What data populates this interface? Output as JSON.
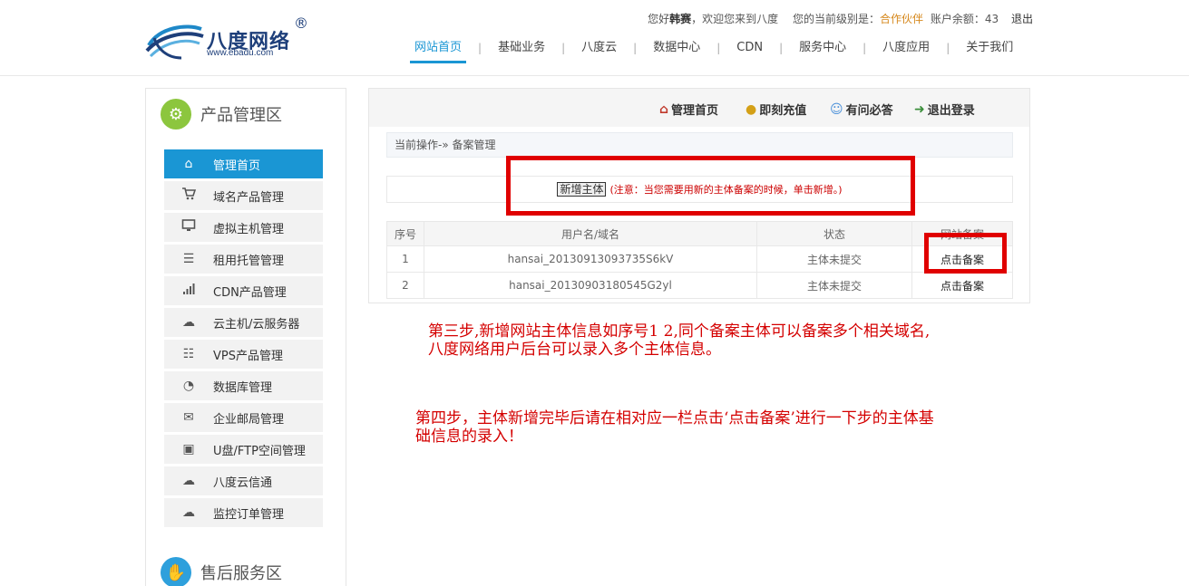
{
  "header": {
    "logo_text": "八度网络",
    "logo_url": "www.ebadu.com",
    "logo_reg": "®",
    "greeting": "您好",
    "username": "韩赛",
    "welcome": "，欢迎您来到八度",
    "level_label": "您的当前级别是：",
    "level_value": "合作伙伴",
    "balance_label": "账户余额：",
    "balance_value": "43",
    "logout": "退出"
  },
  "nav": [
    {
      "label": "网站首页"
    },
    {
      "label": "基础业务"
    },
    {
      "label": "八度云"
    },
    {
      "label": "数据中心"
    },
    {
      "label": "CDN"
    },
    {
      "label": "服务中心"
    },
    {
      "label": "八度应用"
    },
    {
      "label": "关于我们"
    }
  ],
  "nav_separator": "|",
  "sidebar": {
    "section1_title": "产品管理区",
    "section2_title": "售后服务区",
    "items": [
      {
        "label": "管理首页",
        "icon": "home-icon",
        "glyph": "⌂"
      },
      {
        "label": "域名产品管理",
        "icon": "cart-icon",
        "glyph": "🛒"
      },
      {
        "label": "虚拟主机管理",
        "icon": "monitor-icon",
        "glyph": "▭"
      },
      {
        "label": "租用托管管理",
        "icon": "list-icon",
        "glyph": "☰"
      },
      {
        "label": "CDN产品管理",
        "icon": "signal-icon",
        "glyph": "▮"
      },
      {
        "label": "云主机/云服务器",
        "icon": "cloud-icon",
        "glyph": "☁"
      },
      {
        "label": "VPS产品管理",
        "icon": "grid-list-icon",
        "glyph": "☷"
      },
      {
        "label": "数据库管理",
        "icon": "pie-icon",
        "glyph": "◔"
      },
      {
        "label": "企业邮局管理",
        "icon": "mail-icon",
        "glyph": "✉"
      },
      {
        "label": "U盘/FTP空间管理",
        "icon": "usb-icon",
        "glyph": "▣"
      },
      {
        "label": "八度云信通",
        "icon": "cloud-icon",
        "glyph": "☁"
      },
      {
        "label": "监控订单管理",
        "icon": "cloud-icon",
        "glyph": "☁"
      }
    ]
  },
  "toolbar": {
    "home": "管理首页",
    "recharge": "即刻充值",
    "faq": "有问必答",
    "logout": "退出登录"
  },
  "breadcrumb": "当前操作-» 备案管理",
  "add": {
    "button": "新增主体",
    "note": "(注意：当您需要用新的主体备案的时候，单击新增。)"
  },
  "table": {
    "headers": [
      "序号",
      "用户名/域名",
      "状态",
      "网站备案"
    ],
    "rows": [
      {
        "no": "1",
        "user": "hansai_20130913093735S6kV",
        "status": "主体未提交",
        "action": "点击备案"
      },
      {
        "no": "2",
        "user": "hansai_20130903180545G2yl",
        "status": "主体未提交",
        "action": "点击备案"
      }
    ]
  },
  "notes": {
    "step3_line1": "第三步,新增网站主体信息如序号1 2,同个备案主体可以备案多个相关域名,",
    "step3_line2": "八度网络用户后台可以录入多个主体信息。",
    "step4_line1": "第四步，主体新增完毕后请在相对应一栏点击‘点击备案’进行一下步的主体基",
    "step4_line2": "础信息的录入！"
  },
  "colors": {
    "accent": "#1a96d4",
    "annotation_red": "#e00000",
    "level": "#d6881c"
  }
}
